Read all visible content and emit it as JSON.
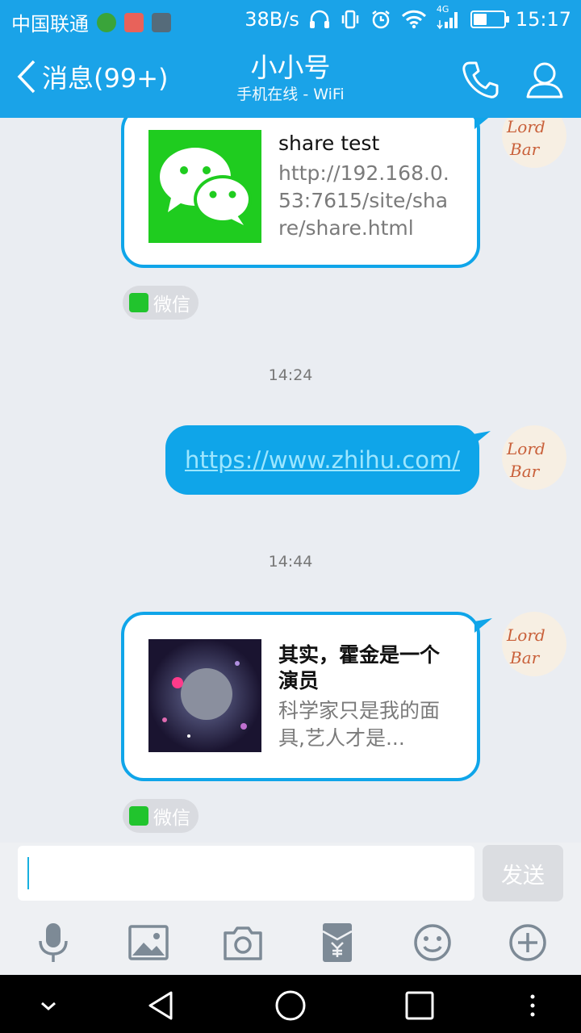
{
  "status_bar": {
    "carrier": "中国联通",
    "net_speed": "38B/s",
    "network": "4G",
    "time": "15:17",
    "battery_level": 0.45
  },
  "header": {
    "back_label": "消息(99+)",
    "title": "小小号",
    "subtitle": "手机在线 - WiFi"
  },
  "messages": {
    "card1": {
      "title": "share test",
      "desc": "http://192.168.0.53:7615/site/share/share.html",
      "source": "微信"
    },
    "time1": "14:24",
    "link_text": "https://www.zhihu.com/",
    "time2": "14:44",
    "card2": {
      "title": "其实，霍金是一个演员",
      "desc": "科学家只是我的面具,艺人才是...",
      "source": "微信"
    }
  },
  "avatar": {
    "text": "Lord Bar"
  },
  "input": {
    "value": "",
    "send_label": "发送"
  },
  "colors": {
    "accent": "#1aa3e8",
    "bubble": "#0fa5e9",
    "wechat_green": "#21c42d"
  }
}
